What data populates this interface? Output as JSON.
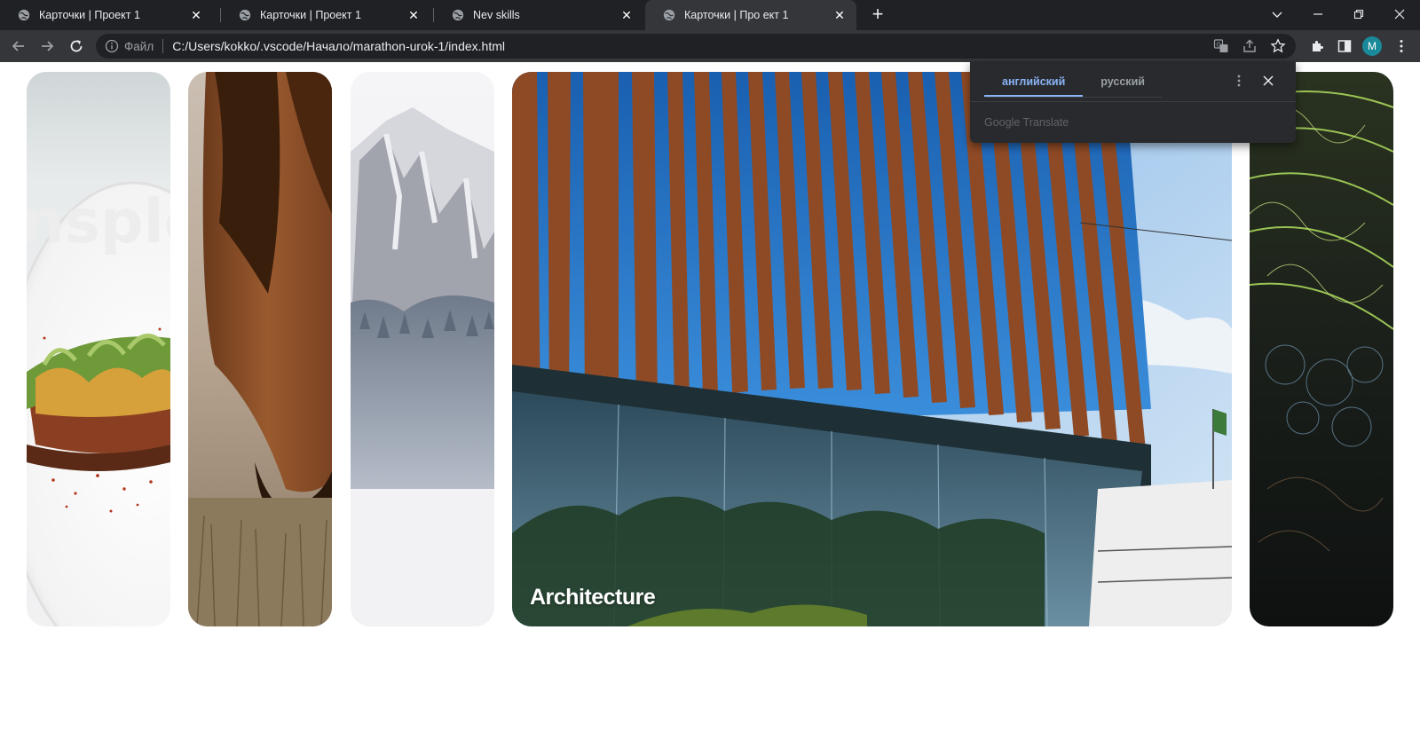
{
  "tabs": [
    {
      "title": "Карточки | Проект 1",
      "active": false
    },
    {
      "title": "Карточки | Проект 1",
      "active": false
    },
    {
      "title": "Nev skills",
      "active": false
    },
    {
      "title": "Карточки | Про ект 1",
      "active": true
    }
  ],
  "toolbar": {
    "scheme_label": "Файл",
    "url": "C:/Users/kokko/.vscode/Начало/marathon-urok-1/index.html",
    "avatar_letter": "M"
  },
  "panels": [
    {
      "name": "food",
      "caption": ""
    },
    {
      "name": "horse",
      "caption": ""
    },
    {
      "name": "mountain",
      "caption": ""
    },
    {
      "name": "architecture",
      "caption": "Architecture"
    },
    {
      "name": "lights",
      "caption": ""
    }
  ],
  "translate_popup": {
    "source_lang": "английский",
    "target_lang": "русский",
    "brand": "Google Translate"
  },
  "colors": {
    "tabstrip": "#202124",
    "toolbar": "#35363a",
    "accent": "#8ab4f8"
  }
}
